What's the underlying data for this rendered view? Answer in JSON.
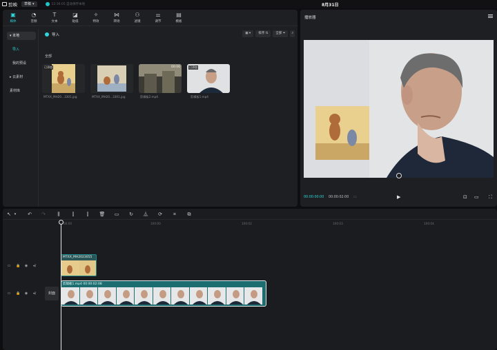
{
  "topbar": {
    "logo_text": "剪映",
    "draft_label": "草稿",
    "save_status": "12:36:05 自动保存本地",
    "date": "8月31日"
  },
  "tools": [
    {
      "label": "媒体",
      "icon": "media-icon"
    },
    {
      "label": "音频",
      "icon": "audio-icon"
    },
    {
      "label": "文本",
      "icon": "text-icon"
    },
    {
      "label": "贴纸",
      "icon": "sticker-icon"
    },
    {
      "label": "特效",
      "icon": "effects-icon"
    },
    {
      "label": "转场",
      "icon": "transition-icon"
    },
    {
      "label": "滤镜",
      "icon": "filter-icon"
    },
    {
      "label": "调节",
      "icon": "adjust-icon"
    },
    {
      "label": "模板",
      "icon": "template-icon"
    }
  ],
  "sidebar": {
    "items": [
      "本地",
      "导入",
      "我的预设",
      "云素材",
      "素材库"
    ]
  },
  "media": {
    "import_label": "导入",
    "sort_label": "排序",
    "filter_label": "全部",
    "all_label": "全部",
    "added_badge": "已添加",
    "items": [
      {
        "name": "MTXX_MH20...3301.jpg",
        "added": true,
        "duration": ""
      },
      {
        "name": "MTXX_MH20...3301.jpg",
        "added": false,
        "duration": ""
      },
      {
        "name": "剪辑板2.mp4",
        "added": false,
        "duration": "00:06"
      },
      {
        "name": "剪辑板1.mp4",
        "added": true,
        "duration": ""
      }
    ]
  },
  "player": {
    "title": "播放器",
    "time_current": "00:00:00:00",
    "time_total": "00:00:02:00"
  },
  "timeline": {
    "ruler_ticks": [
      "00:00",
      "100:00",
      "100:02",
      "100:03",
      "100:04"
    ],
    "image_clip_label": "MTXX_MH2023055",
    "video_clip_label": "剪辑板1.mp4   00:00:02:08",
    "cover_label": "封面"
  },
  "colors": {
    "accent": "#2ed6dc",
    "clip_teal": "#1c6d6f"
  }
}
